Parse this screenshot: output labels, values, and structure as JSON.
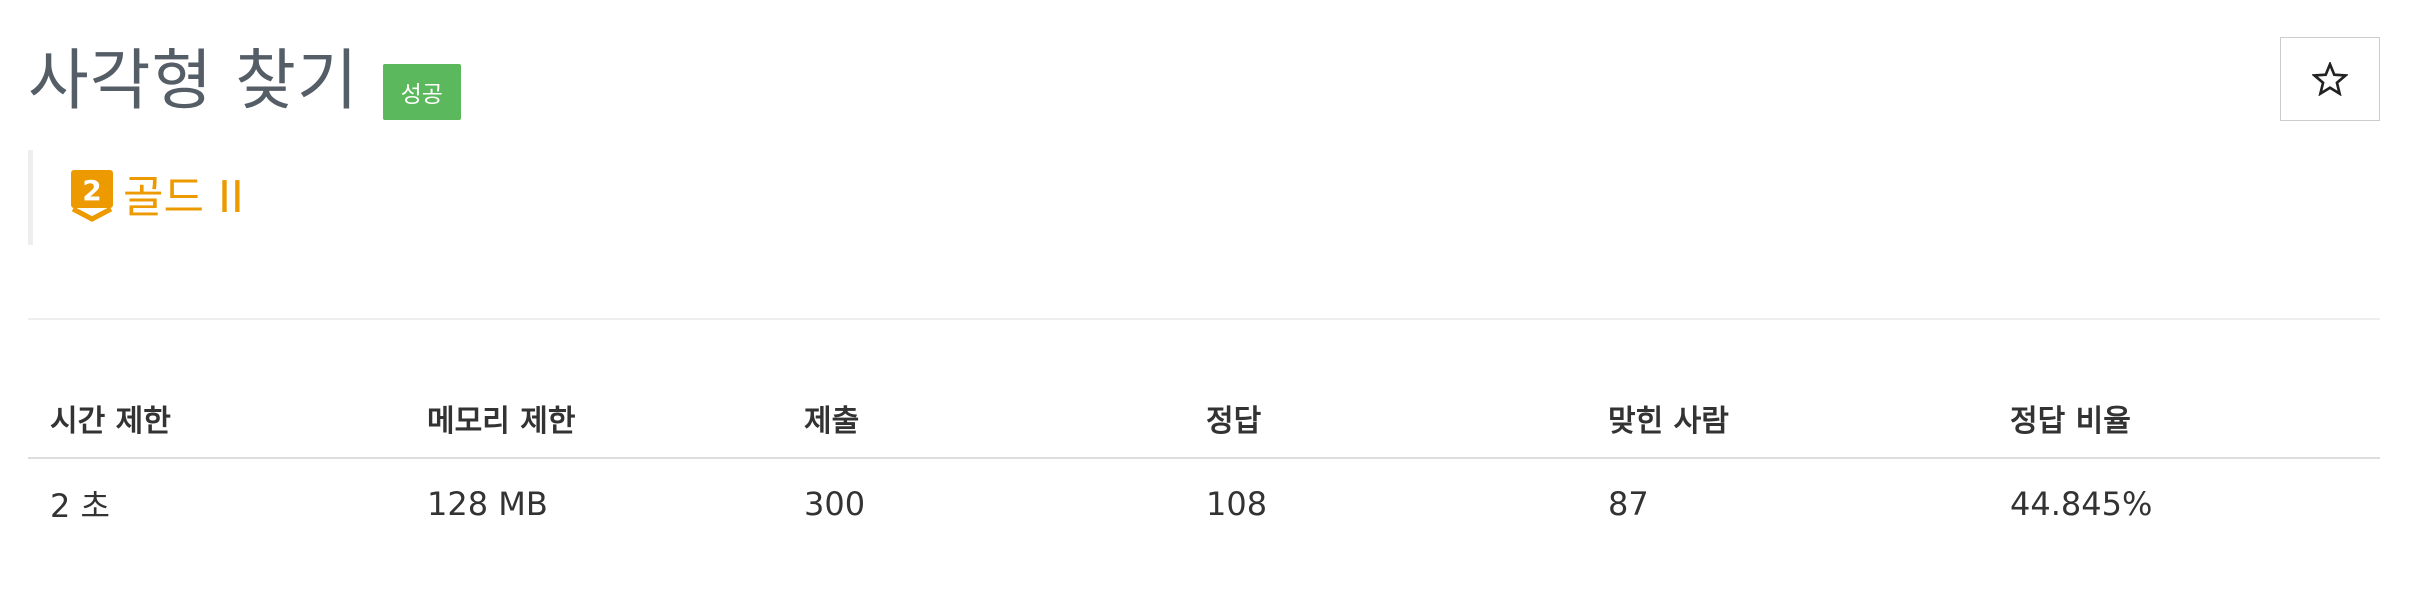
{
  "problem": {
    "title": "사각형 찾기",
    "result_badge": "성공",
    "tier": {
      "level_number": "2",
      "name": "골드 II",
      "color": "#ec9a00"
    }
  },
  "star_button": {
    "icon": "star-outline-icon"
  },
  "colors": {
    "badge_success": "#5cb85c",
    "tier_gold": "#ec9a00",
    "title": "#555d67"
  },
  "info_table": {
    "headers": [
      "시간 제한",
      "메모리 제한",
      "제출",
      "정답",
      "맞힌 사람",
      "정답 비율"
    ],
    "values": [
      "2 초",
      "128 MB",
      "300",
      "108",
      "87",
      "44.845%"
    ]
  }
}
